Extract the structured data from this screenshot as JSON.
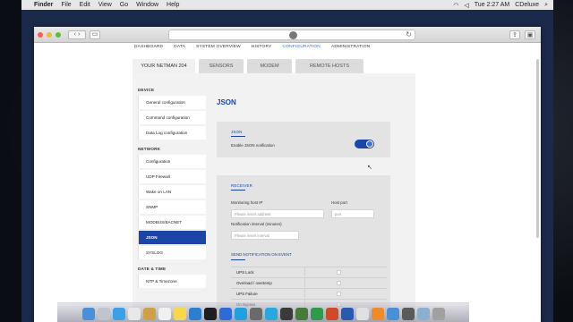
{
  "menubar": {
    "items": [
      "Finder",
      "File",
      "Edit",
      "View",
      "Go",
      "Window",
      "Help"
    ],
    "clock": "Tue 2:27 AM",
    "user": "CDeluxe"
  },
  "browser": {
    "nav_back": "‹",
    "nav_forward": "›"
  },
  "topnav": [
    "DASHBOARD",
    "DATA",
    "SYSTEM OVERVIEW",
    "HISTORY",
    "CONFIGURATION",
    "ADMINISTRATION"
  ],
  "tabs": [
    "YOUR NETMAN 204",
    "SENSORS",
    "MODEM",
    "REMOTE HOSTS"
  ],
  "sidebar": {
    "device_title": "DEVICE",
    "device_items": [
      "General configuration",
      "Command configuration",
      "Data Log configuration"
    ],
    "network_title": "NETWORK",
    "network_items": [
      "Configuration",
      "UDP Firewall",
      "Wake on LAN",
      "SNMP",
      "MODBUS/BACNET",
      "JSON",
      "SYSLOG"
    ],
    "datetime_title": "DATE & TIME",
    "datetime_items": [
      "NTP & Timezone"
    ]
  },
  "main": {
    "title": "JSON",
    "json_panel": {
      "title": "JSON",
      "enable_label": "Enable JSON notification",
      "enabled": true
    },
    "receiver_panel": {
      "title": "RECEIVER",
      "host_ip_label": "Monitoring host IP",
      "host_ip_placeholder": "Please insert address",
      "port_label": "Host port",
      "port_placeholder": "port",
      "interval_label": "Notification interval (minutes)",
      "interval_placeholder": "Please insert interval",
      "events_title": "SEND NOTIFICATION ON EVENT",
      "events": [
        "UPS Lock",
        "Overload / overtemp",
        "UPS Failure",
        "On Bypass"
      ]
    }
  },
  "colors": {
    "accent": "#1b46a8",
    "panel": "#e3e3e3"
  }
}
